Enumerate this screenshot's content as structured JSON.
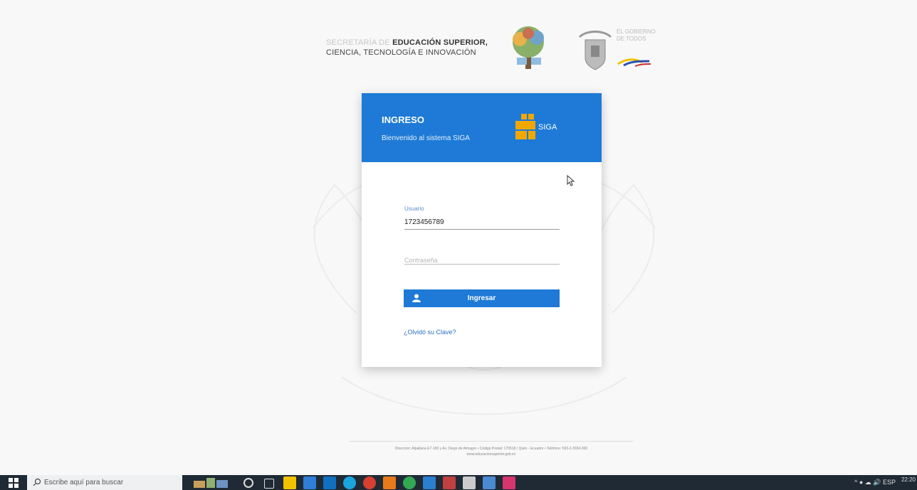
{
  "header": {
    "secretaria_light": "SECRETARÍA DE",
    "secretaria_dark": "EDUCACIÓN SUPERIOR,",
    "secretaria_line2": "CIENCIA, TECNOLOGÍA E INNOVACIÓN",
    "gov_text": "EL GOBIERNO DE TODOS"
  },
  "login": {
    "title": "INGRESO",
    "subtitle": "Bienvenido al sistema SIGA",
    "logo_text": "SIGA",
    "user_label": "Usuario",
    "user_value": "1723456789",
    "password_placeholder": "Contraseña",
    "submit_label": "Ingresar",
    "forgot_label": "¿Olvidó su Clave?"
  },
  "footer": {
    "line1": "Dirección: Alpallana E7-183 y Av. Diego de Almagro • Código Postal: 170518 / Quito - Ecuador • Teléfono: 593-2-3934-300",
    "line2": "www.educacionsuperior.gob.ec"
  },
  "taskbar": {
    "search_placeholder": "Escribe aquí para buscar",
    "tray": "^ ● ☁ 🔊 ESP",
    "clock": "22:20"
  },
  "colors": {
    "primary": "#1e7ad6",
    "siga_orange": "#f0a800"
  }
}
